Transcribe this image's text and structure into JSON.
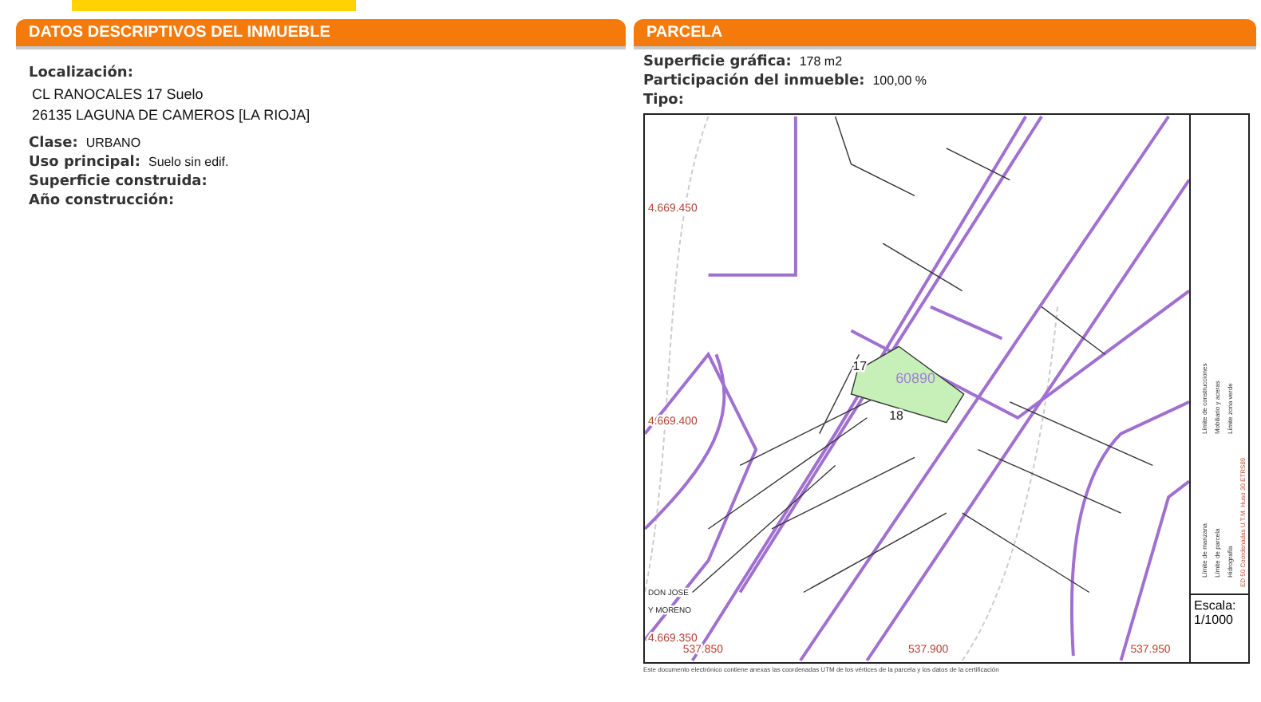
{
  "left_panel": {
    "title": "DATOS DESCRIPTIVOS DEL INMUEBLE",
    "location_label": "Localización:",
    "address_lines": [
      "CL RANOCALES 17 Suelo",
      "26135 LAGUNA DE CAMEROS [LA RIOJA]"
    ],
    "fields": [
      {
        "label": "Clase:",
        "value": "URBANO"
      },
      {
        "label": "Uso principal:",
        "value": "Suelo sin edif."
      },
      {
        "label": "Superficie construida:"
      },
      {
        "label": "Año construcción:"
      }
    ]
  },
  "right_panel": {
    "title": "PARCELA",
    "fields": [
      {
        "label": "Superficie gráfica:",
        "value": "178 m2"
      },
      {
        "label": "Participación del inmueble:",
        "value": "100,00 %"
      },
      {
        "label": "Tipo:"
      }
    ],
    "map": {
      "y_coordinates": [
        "4.669.450",
        "4.669.400",
        "4.669.350"
      ],
      "x_coordinates": [
        "537.850",
        "537.900",
        "537.950"
      ],
      "parcel_numbers": [
        "17",
        "18"
      ],
      "parcel_code": "60890",
      "place_label": [
        "DON JOSE",
        "Y MORENO"
      ],
      "legend": [
        "Límite de manzana",
        "Límite de parcela",
        "Hidrografía",
        "Límite de construcciones",
        "Mobiliario y aceras",
        "Límite zona verde"
      ],
      "projection": "ED 50 Coordenadas U.T.M. Huso 30 ETRS89",
      "notice": "Este documento electrónico contiene anexas las coordenadas UTM de los vértices de la parcela y los datos de la certificación",
      "scale_label": "Escala:",
      "scale_value": "1/1000"
    }
  }
}
